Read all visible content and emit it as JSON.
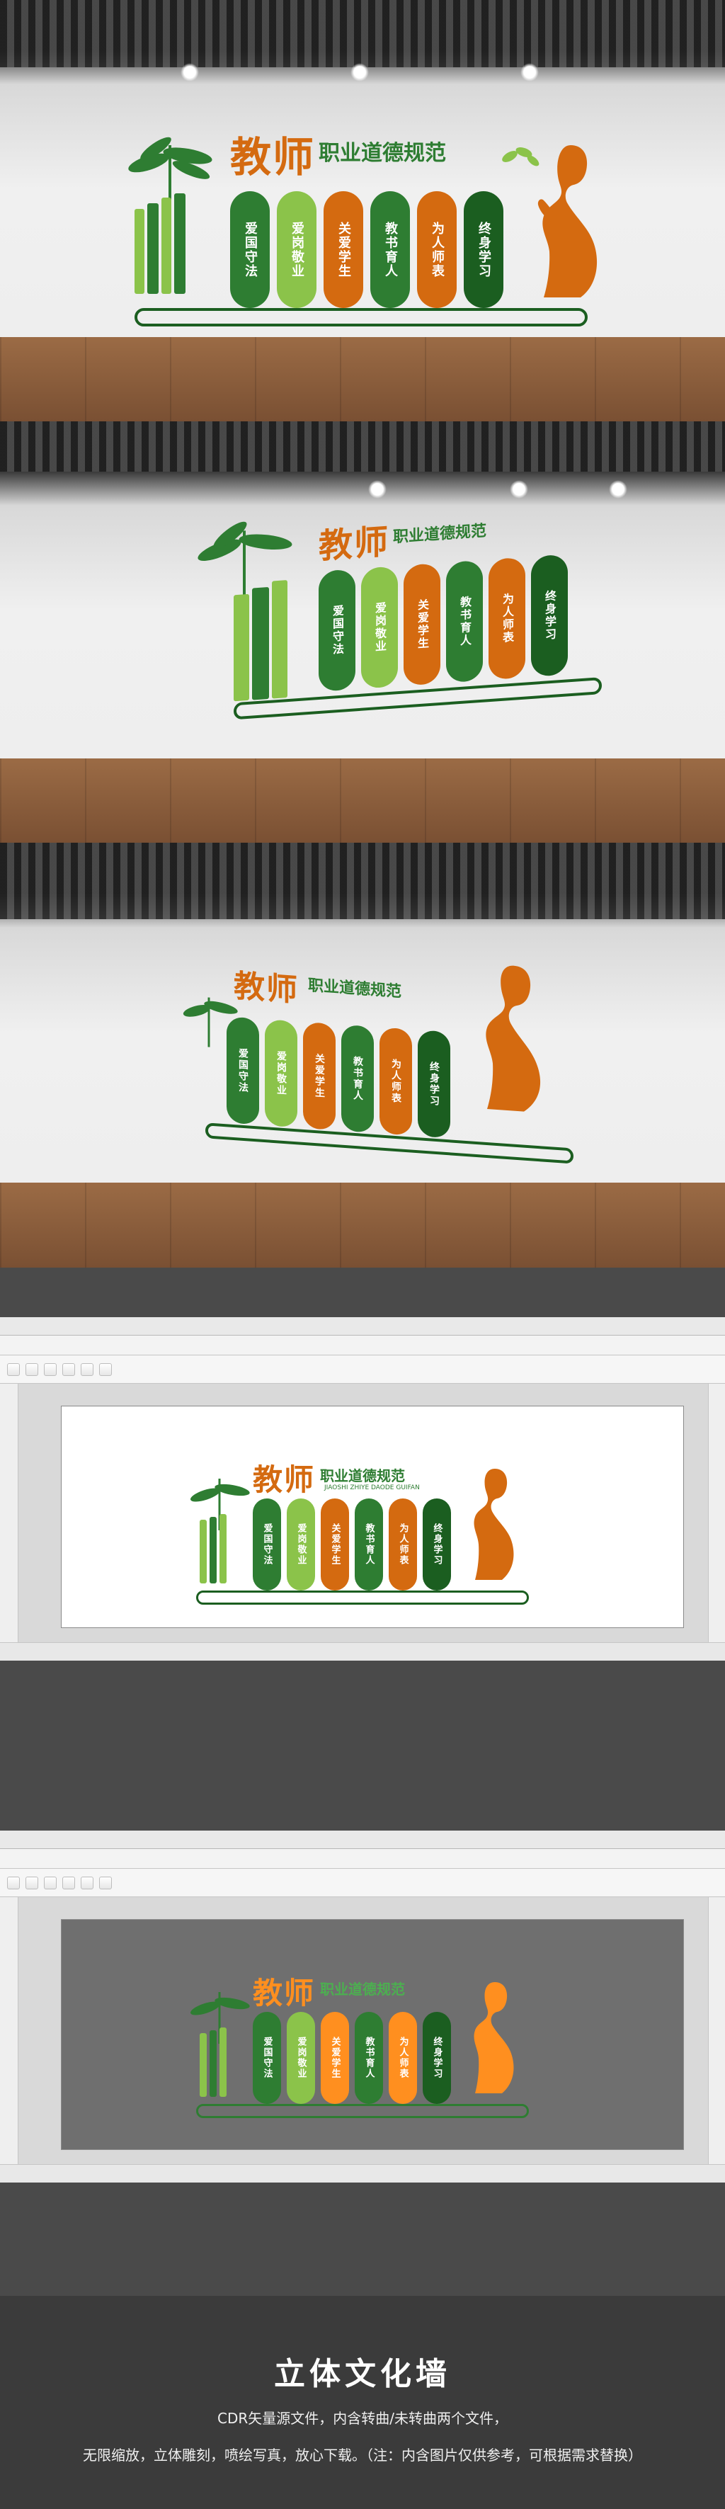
{
  "panels": [
    {
      "kind": "room",
      "labels": [
        "爱国守法",
        "爱岗敬业",
        "关爱学生",
        "教书育人",
        "为人师表",
        "终身学习"
      ]
    },
    {
      "kind": "room",
      "labels": [
        "爱国守法",
        "爱岗敬业",
        "关爱学生",
        "教书育人",
        "为人师表",
        "终身学习"
      ]
    },
    {
      "kind": "room",
      "labels": [
        "爱国守法",
        "爱岗敬业",
        "关爱学生",
        "教书育人",
        "为人师表",
        "终身学习"
      ]
    },
    {
      "kind": "cdr",
      "canvas_bg": "#ffffff",
      "labels": [
        "爱国守法",
        "爱岗敬业",
        "关爱学生",
        "教书育人",
        "为人师表",
        "终身学习"
      ]
    },
    {
      "kind": "cdr",
      "canvas_bg": "#6f6f6f",
      "labels": [
        "爱国守法",
        "爱岗敬业",
        "关爱学生",
        "教书育人",
        "为人师表",
        "终身学习"
      ]
    }
  ],
  "artwork": {
    "main_title": "教师",
    "subtitle": "职业道德规范",
    "subtitle_en": "JIAOSHI ZHIYE DAODE GUIFAN"
  },
  "footer": {
    "title": "立体文化墙",
    "line1": "CDR矢量源文件，内含转曲/未转曲两个文件，",
    "line2": "无限缩放，立体雕刻，喷绘写真，放心下载。（注：内含图片仅供参考，可根据需求替换）"
  },
  "colors": {
    "green": "#2e7d32",
    "light_green": "#8bc34a",
    "orange": "#d46a10",
    "dark_green": "#1b5e20"
  }
}
